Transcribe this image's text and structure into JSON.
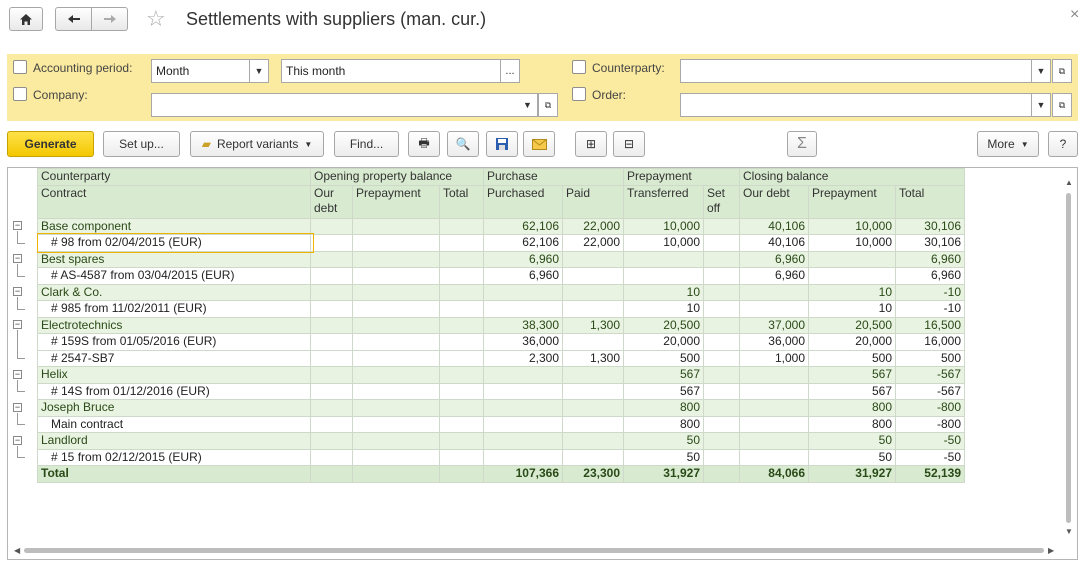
{
  "window": {
    "title": "Settlements with suppliers (man. cur.)",
    "home_icon": "home-icon",
    "back_icon": "arrow-left-icon",
    "forward_icon": "arrow-right-icon",
    "favorite_icon": "star-icon",
    "close_icon": "close-icon"
  },
  "filters": {
    "accounting_period_label": "Accounting period:",
    "period_type": "Month",
    "period_value": "This month",
    "period_more": "...",
    "company_label": "Company:",
    "company_value": "",
    "counterparty_label": "Counterparty:",
    "counterparty_value": "",
    "order_label": "Order:",
    "order_value": ""
  },
  "toolbar": {
    "generate": "Generate",
    "setup": "Set up...",
    "report_variants": "Report variants",
    "find": "Find...",
    "more": "More",
    "help": "?",
    "sum": "Σ"
  },
  "table": {
    "header": {
      "counterparty": "Counterparty",
      "contract": "Contract",
      "opening": "Opening property balance",
      "our_debt": "Our debt",
      "prepayment": "Prepayment",
      "total": "Total",
      "purchase": "Purchase",
      "purchased": "Purchased",
      "paid": "Paid",
      "prepayment_grp": "Prepayment",
      "transferred": "Transferred",
      "set_off": "Set off",
      "closing": "Closing balance",
      "c_our_debt": "Our debt",
      "c_prepayment": "Prepayment",
      "c_total": "Total"
    },
    "rows": [
      {
        "kind": "grp",
        "name": "Base component",
        "o_debt": "",
        "o_prep": "",
        "o_total": "",
        "purchased": "62,106",
        "paid": "22,000",
        "transferred": "10,000",
        "set_off": "",
        "c_debt": "40,106",
        "c_prep": "10,000",
        "c_total": "30,106"
      },
      {
        "kind": "sub",
        "name": "# 98 from 02/04/2015 (EUR)",
        "o_debt": "",
        "o_prep": "",
        "o_total": "",
        "purchased": "62,106",
        "paid": "22,000",
        "transferred": "10,000",
        "set_off": "",
        "c_debt": "40,106",
        "c_prep": "10,000",
        "c_total": "30,106"
      },
      {
        "kind": "grp",
        "name": "Best spares",
        "o_debt": "",
        "o_prep": "",
        "o_total": "",
        "purchased": "6,960",
        "paid": "",
        "transferred": "",
        "set_off": "",
        "c_debt": "6,960",
        "c_prep": "",
        "c_total": "6,960"
      },
      {
        "kind": "sub",
        "name": "# AS-4587 from 03/04/2015 (EUR)",
        "o_debt": "",
        "o_prep": "",
        "o_total": "",
        "purchased": "6,960",
        "paid": "",
        "transferred": "",
        "set_off": "",
        "c_debt": "6,960",
        "c_prep": "",
        "c_total": "6,960"
      },
      {
        "kind": "grp",
        "name": "Clark & Co.",
        "o_debt": "",
        "o_prep": "",
        "o_total": "",
        "purchased": "",
        "paid": "",
        "transferred": "10",
        "set_off": "",
        "c_debt": "",
        "c_prep": "10",
        "c_total": "-10"
      },
      {
        "kind": "sub",
        "name": "# 985 from 11/02/2011 (EUR)",
        "o_debt": "",
        "o_prep": "",
        "o_total": "",
        "purchased": "",
        "paid": "",
        "transferred": "10",
        "set_off": "",
        "c_debt": "",
        "c_prep": "10",
        "c_total": "-10"
      },
      {
        "kind": "grp",
        "name": "Electrotechnics",
        "o_debt": "",
        "o_prep": "",
        "o_total": "",
        "purchased": "38,300",
        "paid": "1,300",
        "transferred": "20,500",
        "set_off": "",
        "c_debt": "37,000",
        "c_prep": "20,500",
        "c_total": "16,500"
      },
      {
        "kind": "sub",
        "name": "# 159S from 01/05/2016 (EUR)",
        "o_debt": "",
        "o_prep": "",
        "o_total": "",
        "purchased": "36,000",
        "paid": "",
        "transferred": "20,000",
        "set_off": "",
        "c_debt": "36,000",
        "c_prep": "20,000",
        "c_total": "16,000"
      },
      {
        "kind": "sub",
        "name": "# 2547-SB7",
        "o_debt": "",
        "o_prep": "",
        "o_total": "",
        "purchased": "2,300",
        "paid": "1,300",
        "transferred": "500",
        "set_off": "",
        "c_debt": "1,000",
        "c_prep": "500",
        "c_total": "500"
      },
      {
        "kind": "grp",
        "name": "Helix",
        "o_debt": "",
        "o_prep": "",
        "o_total": "",
        "purchased": "",
        "paid": "",
        "transferred": "567",
        "set_off": "",
        "c_debt": "",
        "c_prep": "567",
        "c_total": "-567"
      },
      {
        "kind": "sub",
        "name": "# 14S from 01/12/2016 (EUR)",
        "o_debt": "",
        "o_prep": "",
        "o_total": "",
        "purchased": "",
        "paid": "",
        "transferred": "567",
        "set_off": "",
        "c_debt": "",
        "c_prep": "567",
        "c_total": "-567"
      },
      {
        "kind": "grp",
        "name": "Joseph Bruce",
        "o_debt": "",
        "o_prep": "",
        "o_total": "",
        "purchased": "",
        "paid": "",
        "transferred": "800",
        "set_off": "",
        "c_debt": "",
        "c_prep": "800",
        "c_total": "-800"
      },
      {
        "kind": "sub",
        "name": "Main contract",
        "o_debt": "",
        "o_prep": "",
        "o_total": "",
        "purchased": "",
        "paid": "",
        "transferred": "800",
        "set_off": "",
        "c_debt": "",
        "c_prep": "800",
        "c_total": "-800"
      },
      {
        "kind": "grp",
        "name": "Landlord",
        "o_debt": "",
        "o_prep": "",
        "o_total": "",
        "purchased": "",
        "paid": "",
        "transferred": "50",
        "set_off": "",
        "c_debt": "",
        "c_prep": "50",
        "c_total": "-50"
      },
      {
        "kind": "sub",
        "name": "# 15 from 02/12/2015 (EUR)",
        "o_debt": "",
        "o_prep": "",
        "o_total": "",
        "purchased": "",
        "paid": "",
        "transferred": "50",
        "set_off": "",
        "c_debt": "",
        "c_prep": "50",
        "c_total": "-50"
      },
      {
        "kind": "tot",
        "name": "Total",
        "o_debt": "",
        "o_prep": "",
        "o_total": "",
        "purchased": "107,366",
        "paid": "23,300",
        "transferred": "31,927",
        "set_off": "",
        "c_debt": "84,066",
        "c_prep": "31,927",
        "c_total": "52,139"
      }
    ]
  }
}
